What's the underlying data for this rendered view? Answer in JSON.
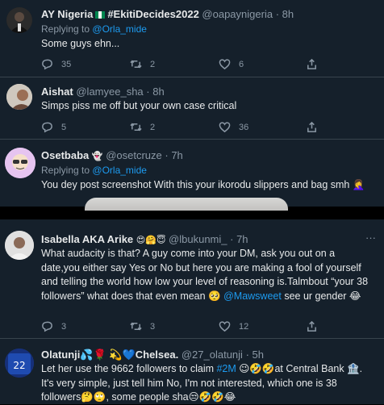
{
  "tweets": [
    {
      "name": "AY Nigeria",
      "flag_icon": "nigeria-flag",
      "hashtag_name": "#EkitiDecides2022",
      "handle": "@oapaynigeria",
      "time": "· 8h",
      "replying_prefix": "Replying to",
      "replying_to": "@Orla_mide",
      "text": "Some guys ehn...",
      "replies": "35",
      "retweets": "2",
      "likes": "6"
    },
    {
      "name": "Aishat",
      "handle": "@lamyee_sha",
      "time": "· 8h",
      "text": "Simps piss me off but your own case critical",
      "replies": "5",
      "retweets": "2",
      "likes": "36"
    },
    {
      "name": "Osetbaba",
      "name_emoji": "👻",
      "handle": "@osetcruze",
      "time": "· 7h",
      "replying_prefix": "Replying to",
      "replying_to": "@Orla_mide",
      "text": "You dey post screenshot With this your  ikorodu slippers  and bag smh 🤦‍♀️"
    },
    {
      "name": "Isabella AKA Arike",
      "name_emoji": "😍🤗😇",
      "handle": "@lbukunmi_",
      "time": "· 7h",
      "text_a": "What audacity is that? A guy come into your DM, ask you out on a date,you either say Yes or No but here you are making a fool of yourself and  telling the world how low your level of reasoning is.Talmbout “your 38 followers” what does that even mean 🥺 ",
      "mention": "@Mawsweet",
      "text_b": " see ur gender 😂",
      "replies": "3",
      "retweets": "3",
      "likes": "12"
    },
    {
      "name": "Olatunji💦🌹 💫💙Chelsea.",
      "handle": "@27_olatunji",
      "time": "· 5h",
      "text_a": "Let her use the 9662 followers to claim ",
      "hashtag": "#2M",
      "text_b": " 😉🤣🤣at Central Bank 🏦. It's very simple, just tell him No, I'm not interested, which one is 38 followers🤔🙄, some people sha😒🤣🤣😂"
    }
  ],
  "colors": {
    "background": "#15202b",
    "separator": "#000000",
    "accent": "#1d9bf0",
    "muted": "#8b98a5"
  },
  "icons": {
    "reply": "reply-icon",
    "retweet": "retweet-icon",
    "like": "heart-icon",
    "share": "share-icon"
  }
}
